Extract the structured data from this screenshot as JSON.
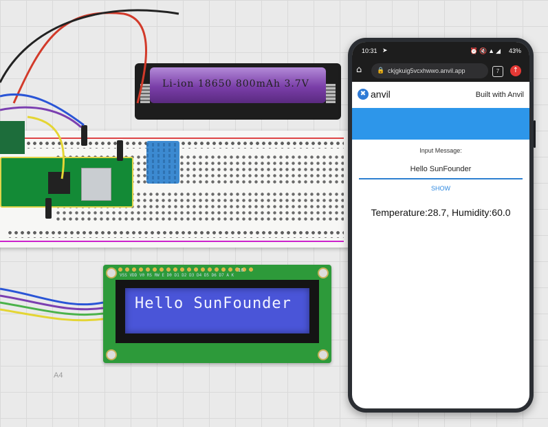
{
  "scene": {
    "mat_label": "A4",
    "battery_text": "Li-ion  18650  800mAh  3.7V",
    "lcd_text": "Hello SunFounder",
    "lcd_silk": "VSS VDD V0 RS RW E D0 D1 D2 D3 D4 D5 D6 D7 A K",
    "lcd_pin_label": "16"
  },
  "phone": {
    "status": {
      "time": "10:31",
      "battery": "43%"
    },
    "browser": {
      "url": "ckjgkuig5vcxhwwo.anvil.app",
      "tab_count": "7"
    },
    "app": {
      "logo_text": "anvil",
      "built_with": "Built with Anvil",
      "input_label": "Input Message:",
      "input_value": "Hello SunFounder",
      "show_label": "SHOW",
      "result": "Temperature:28.7, Humidity:60.0"
    }
  },
  "colors": {
    "accent": "#2d96ea",
    "link": "#2d88e0",
    "lcd_backlight": "#4a55d8",
    "pcb_green": "#2d9a3a"
  }
}
